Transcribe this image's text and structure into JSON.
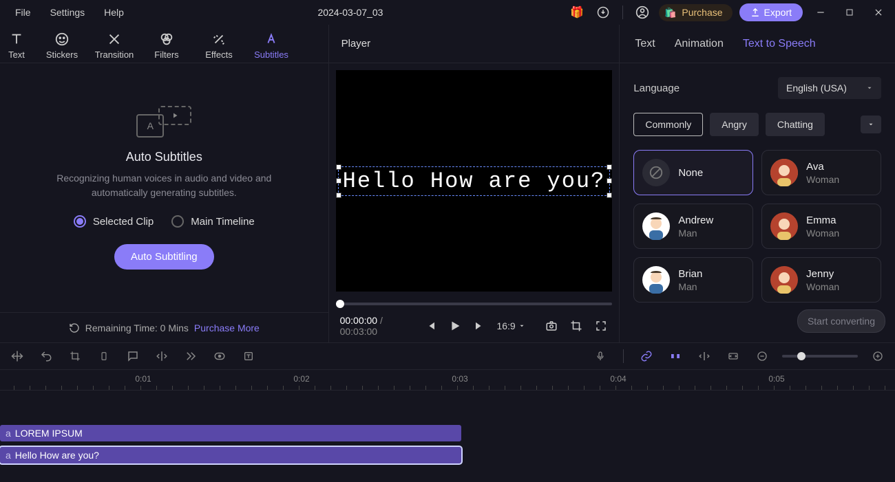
{
  "menu": {
    "file": "File",
    "settings": "Settings",
    "help": "Help"
  },
  "project_title": "2024-03-07_03",
  "titlebar": {
    "purchase": "Purchase",
    "export": "Export"
  },
  "tool_tabs": {
    "text": "Text",
    "stickers": "Stickers",
    "transition": "Transition",
    "filters": "Filters",
    "effects": "Effects",
    "subtitles": "Subtitles"
  },
  "auto_subtitles": {
    "title": "Auto Subtitles",
    "desc": "Recognizing human voices in audio and video and automatically generating subtitles.",
    "opt_selected": "Selected Clip",
    "opt_timeline": "Main Timeline",
    "button": "Auto Subtitling",
    "remaining_prefix": "Remaining Time: 0 Mins ",
    "purchase_more": "Purchase More"
  },
  "player": {
    "label": "Player",
    "subtitle_text": "Hello How are you?",
    "time_current": "00:00:00",
    "time_total": "00:03:00",
    "aspect": "16:9"
  },
  "inspector": {
    "tab_text": "Text",
    "tab_animation": "Animation",
    "tab_tts": "Text to Speech",
    "language_label": "Language",
    "language_value": "English (USA)",
    "pills": {
      "commonly": "Commonly",
      "angry": "Angry",
      "chatting": "Chatting"
    },
    "voices": {
      "none": "None",
      "ava_name": "Ava",
      "ava_role": "Woman",
      "andrew_name": "Andrew",
      "andrew_role": "Man",
      "emma_name": "Emma",
      "emma_role": "Woman",
      "brian_name": "Brian",
      "brian_role": "Man",
      "jenny_name": "Jenny",
      "jenny_role": "Woman"
    },
    "start_convert": "Start converting"
  },
  "ruler": {
    "t1": "0:01",
    "t2": "0:02",
    "t3": "0:03",
    "t4": "0:04",
    "t5": "0:05"
  },
  "clips": {
    "clip1_prefix": "a",
    "clip1_text": "LOREM IPSUM",
    "clip2_prefix": "a",
    "clip2_text": "Hello How are you?"
  }
}
